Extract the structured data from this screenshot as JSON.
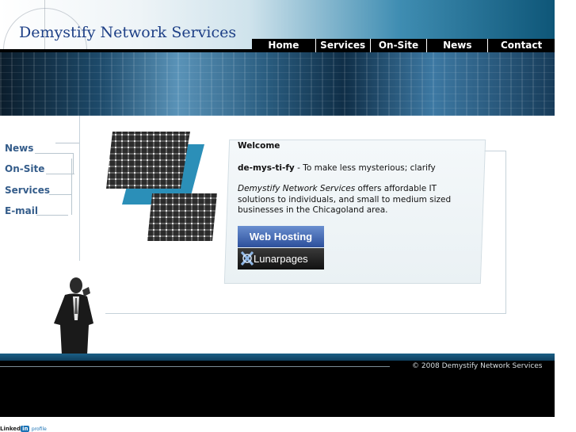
{
  "header": {
    "site_title": "Demystify Network Services"
  },
  "nav": {
    "items": [
      "Home",
      "Services",
      "On-Site",
      "News",
      "Contact"
    ]
  },
  "sidebar": {
    "items": [
      "News",
      "On-Site",
      "Services",
      "E-mail"
    ]
  },
  "main": {
    "heading": "Welcome",
    "definition_term": "de-mys-ti-fy",
    "definition_text": " - To make less mysterious; clarify",
    "company_name": "Demystify Network Services",
    "description": " offers affordable IT solutions to individuals, and small to medium sized businesses in the Chicagoland area."
  },
  "badge": {
    "top_label": "Web Hosting",
    "bottom_label": "Lunarpages"
  },
  "footer": {
    "copyright": "© 2008 Demystify Network Services"
  },
  "linkedin": {
    "linked": "Linked",
    "in": "in",
    "profile": "profile"
  },
  "colors": {
    "nav_background": "#000000",
    "title_color": "#1d3f86",
    "sidebar_link": "#345c8a",
    "footer_accent": "#1b5f86"
  }
}
